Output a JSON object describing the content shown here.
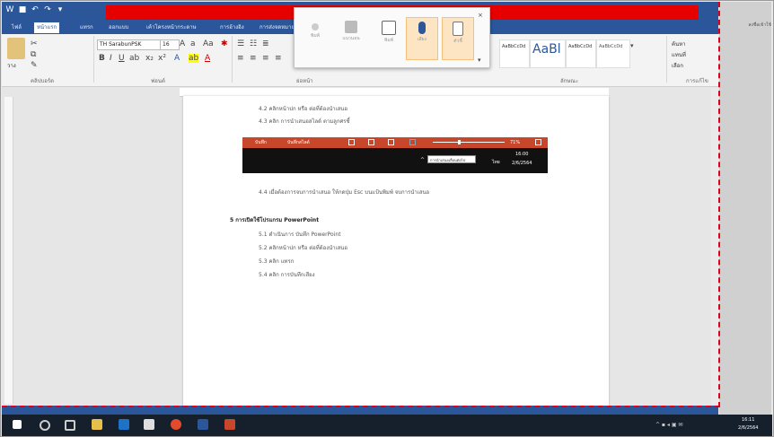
{
  "ribbon": {
    "tabs": [
      "ไฟล์",
      "หน้าแรก",
      "แทรก",
      "ออกแบบ",
      "เค้าโครงหน้ากระดาษ",
      "การอ้างอิง",
      "การส่งจดหมาย"
    ],
    "active_tab_index": 1,
    "font_name": "TH SarabunPSK",
    "font_size": "16",
    "group_clipboard": "คลิปบอร์ด",
    "group_font": "ฟอนต์",
    "group_paragraph": "ย่อหน้า",
    "group_styles": "ลักษณะ",
    "group_editing": "การแก้ไข",
    "style_sample": "AaBl",
    "style_normal": "AaBbCcDd",
    "style_title": "AaBbCcDd",
    "find_label": "ค้นหา",
    "replace_label": "แทนที่",
    "select_label": "เลือก",
    "paste_label": "วาง",
    "signin_label": "ลงชื่อเข้าใช้"
  },
  "floating_toolbar": {
    "items": [
      "พิมพ์",
      "แนวนอน",
      "พิมพ์",
      "เสียง",
      "ตัวชี้"
    ]
  },
  "document": {
    "lines": [
      {
        "text": "4.2 คลิกหน้าปก หรือ ต่อที่ต้องนำเสนอ",
        "indent": true
      },
      {
        "text": "4.3 คลิก การนำเสนอสไลด์ ตามลูกศรชี้",
        "indent": true
      },
      {
        "text": "4.4 เมื่อต้องการจบการนำเสนอ ให้กดปุ่ม Esc บนแป้นพิมพ์ จบการนำเสนอ",
        "indent": true
      },
      {
        "text": "5 การเปิดใช้โปรแกรม PowerPoint",
        "indent": false
      },
      {
        "text": "5.1 ดำเนินการ บันทึก PowerPoint",
        "indent": true
      },
      {
        "text": "5.2 คลิกหน้าปก หรือ ต่อที่ต้องนำเสนอ",
        "indent": true
      },
      {
        "text": "5.3 คลิก แทรก",
        "indent": true
      },
      {
        "text": "5.4 คลิก การบันทึกเสียง",
        "indent": true
      }
    ]
  },
  "slideshow": {
    "left_label": "บันทึก",
    "mid_label": "บันทึกสไลด์",
    "tooltip": "การนำเสนอเลื่อนต่อไป",
    "time": "16:00",
    "date": "2/6/2564",
    "lang": "ไทย",
    "percent": "71%"
  },
  "taskbar": {
    "time": "16:11",
    "date": "2/6/2564"
  },
  "colors": {
    "title_bar": "#2b579a",
    "highlight_band": "#e60000",
    "slideshow_bar": "#c8472b",
    "taskbar": "#161f2c",
    "dashed_border": "#e0001a"
  }
}
